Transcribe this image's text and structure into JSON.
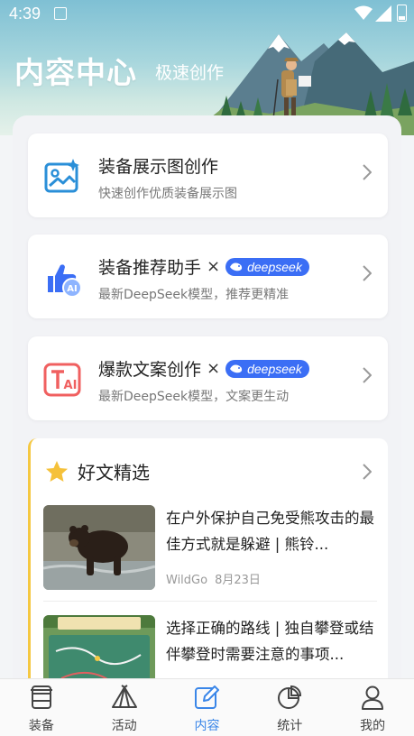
{
  "status_bar": {
    "time": "4:39"
  },
  "header": {
    "title": "内容中心",
    "subtitle": "极速创作"
  },
  "tools": [
    {
      "title": "装备展示图创作",
      "desc": "快速创作优质装备展示图",
      "badge": ""
    },
    {
      "title": "装备推荐助手",
      "times": "×",
      "badge": "deepseek",
      "desc": "最新DeepSeek模型，推荐更精准"
    },
    {
      "title": "爆款文案创作",
      "times": "×",
      "badge": "deepseek",
      "desc": "最新DeepSeek模型，文案更生动"
    }
  ],
  "articles": {
    "title": "好文精选",
    "items": [
      {
        "title": "在户外保护自己免受熊攻击的最佳方式就是躲避 | 熊铃...",
        "author": "WildGo",
        "date": "8月23日"
      },
      {
        "title": "选择正确的路线 | 独自攀登或结伴攀登时需要注意的事项...",
        "author": "",
        "date": ""
      }
    ]
  },
  "tabbar": [
    {
      "label": "装备",
      "icon": "gear-box-icon"
    },
    {
      "label": "活动",
      "icon": "tent-icon"
    },
    {
      "label": "内容",
      "icon": "edit-icon"
    },
    {
      "label": "统计",
      "icon": "pie-chart-icon"
    },
    {
      "label": "我的",
      "icon": "person-icon"
    }
  ],
  "colors": {
    "accent": "#3a86e8",
    "badge": "#3b6ef5",
    "highlight": "#f5c842"
  }
}
